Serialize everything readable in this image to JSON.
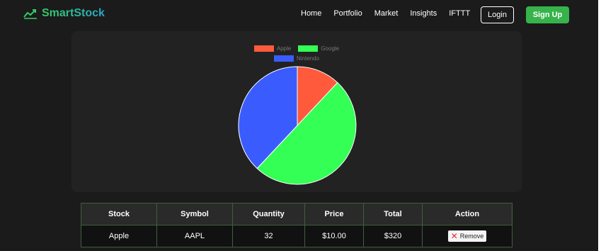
{
  "brand": {
    "name": "SmartStock",
    "icon": "trend-chart-icon"
  },
  "nav": {
    "links": [
      "Home",
      "Portfolio",
      "Market",
      "Insights",
      "IFTTT"
    ],
    "login_label": "Login",
    "signup_label": "Sign Up"
  },
  "colors": {
    "accent_green": "#36b34a",
    "apple": "#ff5a3c",
    "google": "#33ff55",
    "nintendo": "#3a5cff"
  },
  "chart_data": {
    "type": "pie",
    "labels": [
      "Apple",
      "Google",
      "Nintendo"
    ],
    "values": [
      12,
      50,
      38
    ],
    "colors": [
      "#ff5a3c",
      "#33ff55",
      "#3a5cff"
    ],
    "legend_position": "top"
  },
  "table": {
    "headers": [
      "Stock",
      "Symbol",
      "Quantity",
      "Price",
      "Total",
      "Action"
    ],
    "rows": [
      {
        "stock": "Apple",
        "symbol": "AAPL",
        "quantity": "32",
        "price": "$10.00",
        "total": "$320",
        "action": "Remove"
      }
    ]
  }
}
